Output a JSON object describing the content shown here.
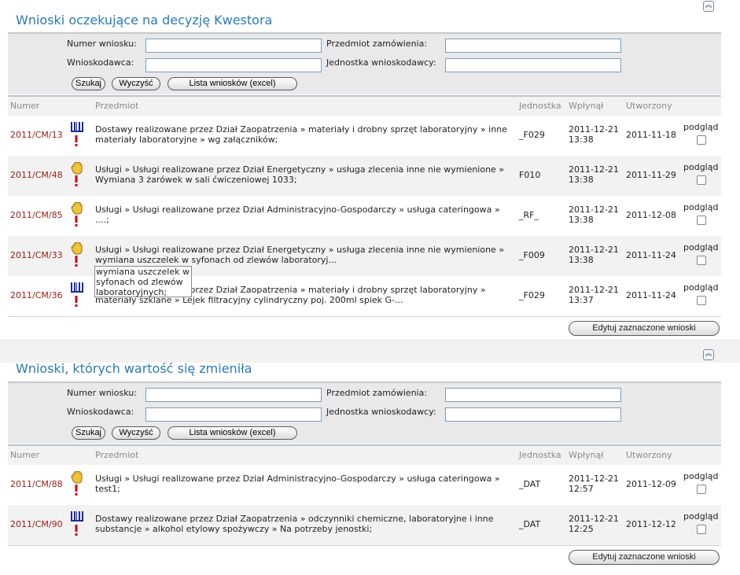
{
  "panels": [
    {
      "title": "Wnioski oczekujące na decyzję Kwestora",
      "filters": {
        "numer_label": "Numer wniosku:",
        "przedmiot_label": "Przedmiot zamówienia:",
        "wnioskodawca_label": "Wnioskodawca:",
        "jednostka_label": "Jednostka wnioskodawcy:",
        "numer_value": "",
        "przedmiot_value": "",
        "wnioskodawca_value": "",
        "jednostka_value": ""
      },
      "buttons": {
        "search": "Szukaj",
        "clear": "Wyczyść",
        "excel": "Lista wniosków (excel)"
      },
      "columns": {
        "numer": "Numer",
        "przedmiot": "Przedmiot",
        "jednostka": "Jednostka",
        "wplynal": "Wpłynął",
        "utworzony": "Utworzony"
      },
      "rows": [
        {
          "numer": "2011/CM/13",
          "icon": "barcode-icon",
          "przedmiot": "Dostawy realizowane przez Dział Zaopatrzenia » materiały i drobny sprzęt laboratoryjny » inne materiały laboratoryjne » wg załączników;",
          "jednostka": "_F029",
          "wplynal": "2011-12-21 13:38",
          "utworzony": "2011-11-18",
          "podglad": "podgląd"
        },
        {
          "numer": "2011/CM/48",
          "icon": "hand-icon",
          "przedmiot": "Usługi » Usługi realizowane przez Dział Energetyczny » usługa zlecenia inne nie wymienione » Wymiana 3 żarówek w sali ćwiczeniowej 1033;",
          "jednostka": "F010",
          "wplynal": "2011-12-21 13:38",
          "utworzony": "2011-11-29",
          "podglad": "podgląd"
        },
        {
          "numer": "2011/CM/85",
          "icon": "hand-icon",
          "przedmiot": "Usługi » Usługi realizowane przez Dział Administracyjno-Gospodarczy » usługa cateringowa » ....;",
          "jednostka": "_RF_",
          "wplynal": "2011-12-21 13:38",
          "utworzony": "2011-12-08",
          "podglad": "podgląd"
        },
        {
          "numer": "2011/CM/33",
          "icon": "hand-icon",
          "przedmiot": "Usługi » Usługi realizowane przez Dział Energetyczny » usługa zlecenia inne nie wymienione » wymiana uszczelek w syfonach od zlewów laboratoryj...",
          "jednostka": "_F009",
          "wplynal": "2011-12-21 13:38",
          "utworzony": "2011-11-24",
          "podglad": "podgląd"
        },
        {
          "numer": "2011/CM/36",
          "icon": "barcode-icon",
          "przedmiot": "Dostawy realizowane przez Dział Zaopatrzenia » materiały i drobny sprzęt laboratoryjny » materiały szklane » Lejek filtracyjny cylindryczny poj. 200ml spiek G-...",
          "jednostka": "_F029",
          "wplynal": "2011-12-21 13:37",
          "utworzony": "2011-11-24",
          "podglad": "podgląd"
        }
      ],
      "edit_button": "Edytuj zaznaczone wnioski"
    },
    {
      "title": "Wnioski, których wartość się zmieniła",
      "filters": {
        "numer_label": "Numer wniosku:",
        "przedmiot_label": "Przedmiot zamówienia:",
        "wnioskodawca_label": "Wnioskodawca:",
        "jednostka_label": "Jednostka wnioskodawcy:",
        "numer_value": "",
        "przedmiot_value": "",
        "wnioskodawca_value": "",
        "jednostka_value": ""
      },
      "buttons": {
        "search": "Szukaj",
        "clear": "Wyczyść",
        "excel": "Lista wniosków (excel)"
      },
      "columns": {
        "numer": "Numer",
        "przedmiot": "Przedmiot",
        "jednostka": "Jednostka",
        "wplynal": "Wpłynął",
        "utworzony": "Utworzony"
      },
      "rows": [
        {
          "numer": "2011/CM/88",
          "icon": "hand-icon",
          "przedmiot": "Usługi » Usługi realizowane przez Dział Administracyjno-Gospodarczy » usługa cateringowa » test1;",
          "jednostka": "_DAT",
          "wplynal": "2011-12-21 12:57",
          "utworzony": "2011-12-09",
          "podglad": "podgląd"
        },
        {
          "numer": "2011/CM/90",
          "icon": "barcode-icon",
          "przedmiot": "Dostawy realizowane przez Dział Zaopatrzenia » odczynniki chemiczne, laboratoryjne i inne substancje » alkohol etylowy spożywczy » Na potrzeby jenostki;",
          "jednostka": "_DAT",
          "wplynal": "2011-12-21 12:25",
          "utworzony": "2011-12-12",
          "podglad": "podgląd"
        }
      ],
      "edit_button": "Edytuj zaznaczone wnioski"
    }
  ],
  "tooltip": "wymiana uszczelek w syfonach od zlewów laboratoryjnych;"
}
